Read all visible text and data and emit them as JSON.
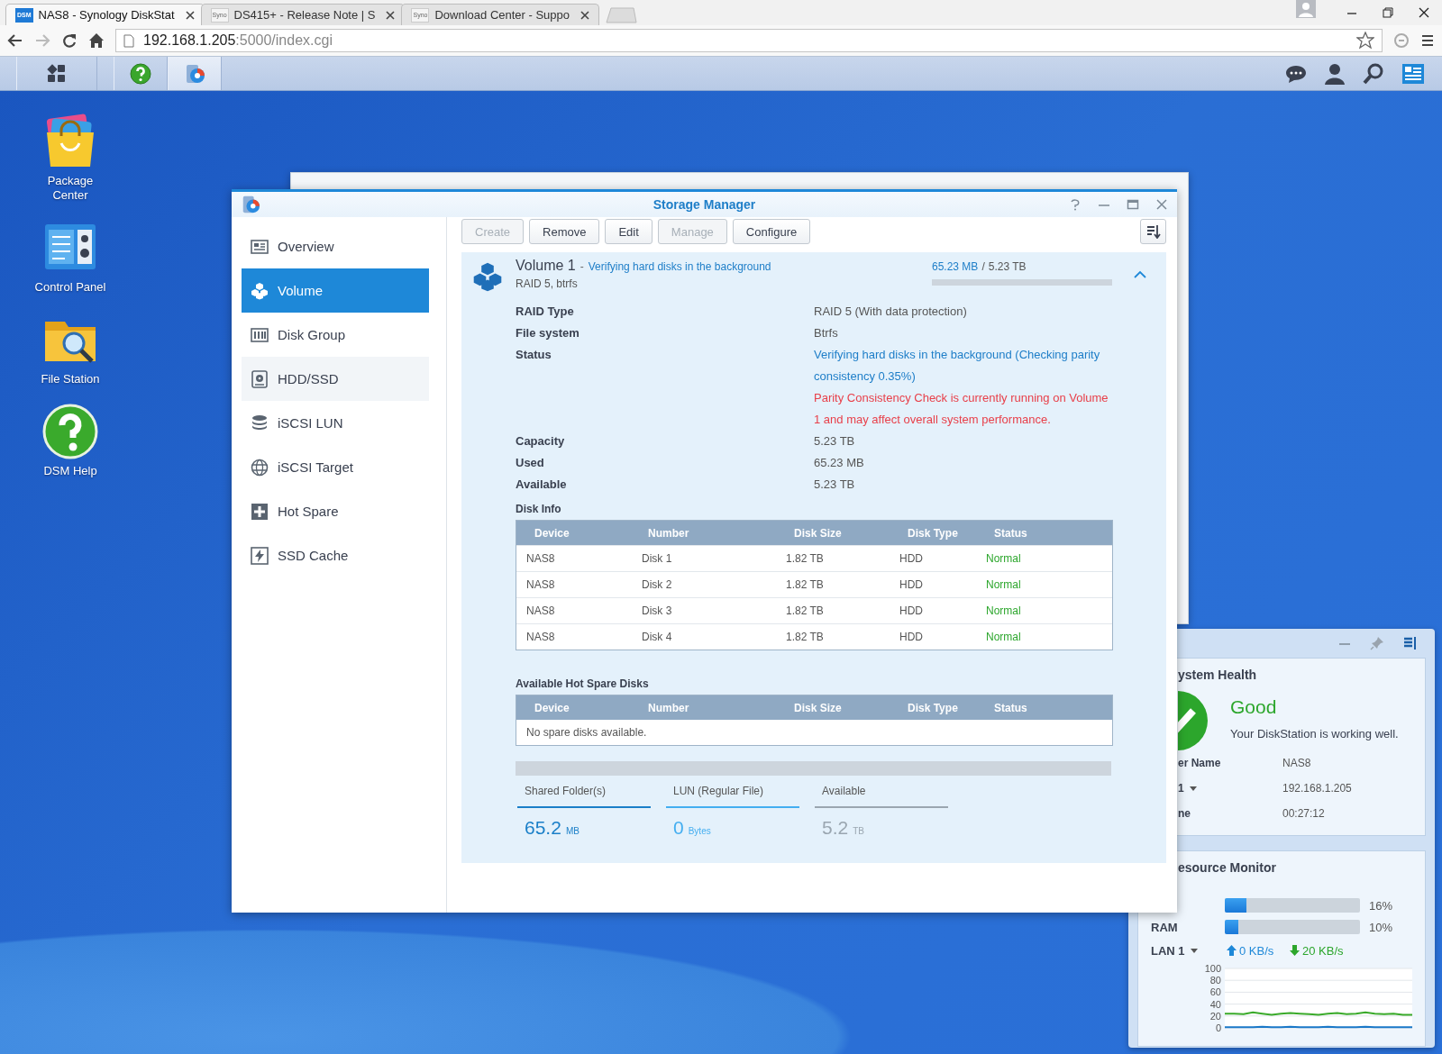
{
  "browser": {
    "tabs": [
      {
        "title": "NAS8 - Synology DiskStat",
        "favicon_text": "DSM",
        "selected": true
      },
      {
        "title": "DS415+ - Release Note | S",
        "favicon_text": "Syno",
        "selected": false
      },
      {
        "title": "Download Center - Suppo",
        "favicon_text": "Syno",
        "selected": false
      }
    ],
    "address": {
      "host": "192.168.1.205",
      "path": ":5000/index.cgi"
    }
  },
  "taskbar": {
    "apps": [
      {
        "kind": "main-menu",
        "selected": false
      },
      {
        "kind": "help",
        "selected": false
      },
      {
        "kind": "storage",
        "selected": true
      }
    ]
  },
  "desktop_icons": [
    {
      "label": "Package Center",
      "kind": "package"
    },
    {
      "label": "Control Panel",
      "kind": "control"
    },
    {
      "label": "File Station",
      "kind": "folder"
    },
    {
      "label": "DSM Help",
      "kind": "help"
    }
  ],
  "storage_manager": {
    "title": "Storage Manager",
    "sidebar": [
      {
        "label": "Overview",
        "kind": "overview",
        "selected": false,
        "hovered": false
      },
      {
        "label": "Volume",
        "kind": "volume",
        "selected": true,
        "hovered": false
      },
      {
        "label": "Disk Group",
        "kind": "diskgroup",
        "selected": false,
        "hovered": false
      },
      {
        "label": "HDD/SSD",
        "kind": "hdd",
        "selected": false,
        "hovered": true
      },
      {
        "label": "iSCSI LUN",
        "kind": "lun",
        "selected": false,
        "hovered": false
      },
      {
        "label": "iSCSI Target",
        "kind": "target",
        "selected": false,
        "hovered": false
      },
      {
        "label": "Hot Spare",
        "kind": "spare",
        "selected": false,
        "hovered": false
      },
      {
        "label": "SSD Cache",
        "kind": "cache",
        "selected": false,
        "hovered": false
      }
    ],
    "toolbar": [
      {
        "label": "Create",
        "disabled": true
      },
      {
        "label": "Remove",
        "disabled": false
      },
      {
        "label": "Edit",
        "disabled": false
      },
      {
        "label": "Manage",
        "disabled": true
      },
      {
        "label": "Configure",
        "disabled": false
      }
    ],
    "volume": {
      "name": "Volume 1",
      "separator": "-",
      "status": "Verifying hard disks in the background",
      "subtitle": "RAID 5, btrfs",
      "expanded": true,
      "usage": {
        "used": "65.23 MB",
        "slash": "/",
        "total": "5.23 TB",
        "level": 0
      },
      "details": [
        {
          "label": "RAID Type",
          "lines": [
            {
              "text": "RAID 5 (With data protection)",
              "kind": "normal"
            }
          ]
        },
        {
          "label": "File system",
          "lines": [
            {
              "text": "Btrfs",
              "kind": "normal"
            }
          ]
        },
        {
          "label": "Status",
          "lines": [
            {
              "text": "Verifying hard disks in the background (Checking parity consistency 0.35%)",
              "kind": "info"
            },
            {
              "text": "Parity Consistency Check is currently running on Volume 1 and may affect overall system performance.",
              "kind": "warning"
            }
          ]
        },
        {
          "label": "Capacity",
          "lines": [
            {
              "text": "5.23 TB",
              "kind": "normal"
            }
          ]
        },
        {
          "label": "Used",
          "lines": [
            {
              "text": "65.23 MB",
              "kind": "normal"
            }
          ]
        },
        {
          "label": "Available",
          "lines": [
            {
              "text": "5.23 TB",
              "kind": "normal"
            }
          ]
        }
      ],
      "disk_info": {
        "title": "Disk Info",
        "columns": [
          "Device",
          "Number",
          "Disk Size",
          "Disk Type",
          "Status"
        ],
        "rows": [
          {
            "cells": [
              "NAS8",
              "Disk 1",
              "1.82 TB",
              "HDD",
              "Normal"
            ]
          },
          {
            "cells": [
              "NAS8",
              "Disk 2",
              "1.82 TB",
              "HDD",
              "Normal"
            ]
          },
          {
            "cells": [
              "NAS8",
              "Disk 3",
              "1.82 TB",
              "HDD",
              "Normal"
            ]
          },
          {
            "cells": [
              "NAS8",
              "Disk 4",
              "1.82 TB",
              "HDD",
              "Normal"
            ]
          }
        ]
      },
      "hot_spare": {
        "title": "Available Hot Spare Disks",
        "columns": [
          "Device",
          "Number",
          "Disk Size",
          "Disk Type",
          "Status"
        ],
        "empty_message": "No spare disks available."
      },
      "stats": [
        {
          "label": "Shared Folder(s)",
          "value": "65.2",
          "unit": "MB",
          "color": "#1a7fc8"
        },
        {
          "label": "LUN (Regular File)",
          "value": "0",
          "unit": "Bytes",
          "color": "#44aef0"
        },
        {
          "label": "Available",
          "value": "5.2",
          "unit": "TB",
          "color": "#9aa6b0"
        }
      ]
    }
  },
  "widget": {
    "health": {
      "title": "ystem Health",
      "status": "Good",
      "message": "Your DiskStation is working well.",
      "rows": [
        {
          "label": "er Name",
          "dropdown": false,
          "value": "NAS8"
        },
        {
          "label": "1",
          "dropdown": true,
          "value": "192.168.1.205"
        },
        {
          "label": "ne",
          "dropdown": false,
          "value": "00:27:12"
        }
      ]
    },
    "resources": {
      "title": "esource Monitor",
      "meters": [
        {
          "level": 0.16,
          "reading": "16%"
        },
        {
          "label": "RAM",
          "level": 0.1,
          "reading": "10%"
        }
      ],
      "network": {
        "label": "LAN 1",
        "upload": "0 KB/s",
        "download": "20 KB/s"
      },
      "chart_data": {
        "type": "line",
        "grid": true,
        "ylim": [
          0,
          100
        ],
        "yticks": [
          0,
          20,
          40,
          60,
          80,
          100
        ],
        "series": [
          {
            "color": "#3aaa2a",
            "values": [
              24,
              24,
              23,
              26,
              24,
              22,
              24,
              25,
              24,
              23,
              22,
              24,
              25,
              23,
              24,
              26,
              24,
              23,
              24,
              22,
              22
            ]
          },
          {
            "color": "#1a78c8",
            "values": [
              1,
              1,
              1,
              1,
              2,
              1,
              1,
              2,
              1,
              1,
              1,
              2,
              1,
              1,
              1,
              2,
              1,
              1,
              1,
              1,
              1
            ]
          }
        ]
      }
    }
  }
}
